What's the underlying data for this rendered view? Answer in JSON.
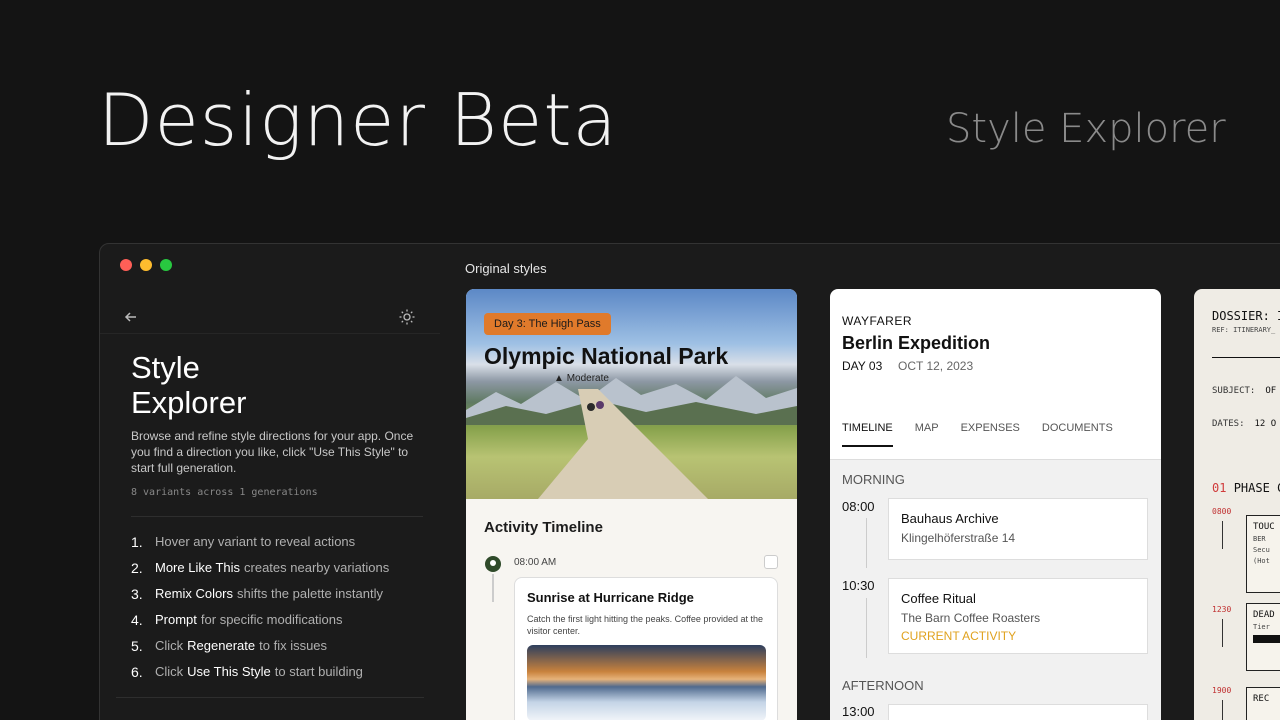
{
  "hero": {
    "title": "Designer Beta",
    "subtitle": "Style Explorer"
  },
  "sidebar": {
    "title_line1": "Style",
    "title_line2": "Explorer",
    "description": "Browse and refine style directions for your app. Once you find a direction you like, click \"Use This Style\" to start full generation.",
    "meta": "8 variants across 1 generations",
    "steps": [
      {
        "num": "1.",
        "em": "",
        "text": "Hover any variant to reveal actions"
      },
      {
        "num": "2.",
        "em": "More Like This",
        "text": "creates nearby variations"
      },
      {
        "num": "3.",
        "em": "Remix Colors",
        "text": "shifts the palette instantly"
      },
      {
        "num": "4.",
        "em": "Prompt",
        "text": "for specific modifications"
      },
      {
        "num": "5.",
        "em": "",
        "text": "Click",
        "em2": "Regenerate",
        "text2": "to fix issues"
      },
      {
        "num": "6.",
        "em": "",
        "text": "Click",
        "em2": "Use This Style",
        "text2": "to start building"
      }
    ]
  },
  "main": {
    "section_label": "Original styles"
  },
  "card_park": {
    "tag": "Day 3: The High Pass",
    "title": "Olympic National Park",
    "difficulty": "Moderate",
    "section": "Activity Timeline",
    "time": "08:00 AM",
    "activity_title": "Sunrise at Hurricane Ridge",
    "activity_desc": "Catch the first light hitting the peaks. Coffee provided at the visitor center."
  },
  "card_berlin": {
    "brand": "WAYFARER",
    "title": "Berlin Expedition",
    "day": "DAY 03",
    "date": "OCT 12, 2023",
    "tabs": [
      "TIMELINE",
      "MAP",
      "EXPENSES",
      "DOCUMENTS"
    ],
    "morning": "MORNING",
    "afternoon": "AFTERNOON",
    "events": [
      {
        "time": "08:00",
        "title": "Bauhaus Archive",
        "sub": "Klingelhöferstraße 14",
        "status": ""
      },
      {
        "time": "10:30",
        "title": "Coffee Ritual",
        "sub": "The Barn Coffee Roasters",
        "status": "CURRENT ACTIVITY"
      }
    ],
    "afternoon_time": "13:00"
  },
  "card_dossier": {
    "title": "DOSSIER: I",
    "ref": "REF: ITINERARY_",
    "subject_label": "SUBJECT:",
    "subject_val": "OF",
    "dates_label": "DATES:",
    "dates_val": "12 O",
    "phase_num": "01",
    "phase_text": "PHASE C",
    "entries": [
      {
        "time": "0800",
        "title": "TOUC",
        "sub1": "BER",
        "sub2": "Secu",
        "sub3": "(Hot"
      },
      {
        "time": "1230",
        "title": "DEAD",
        "sub1": "Tier"
      },
      {
        "time": "1900",
        "title": "REC"
      }
    ]
  },
  "colors": {
    "accent_orange": "#e07a2b",
    "current_activity": "#e0a21e",
    "dossier_red": "#d13b3b"
  }
}
